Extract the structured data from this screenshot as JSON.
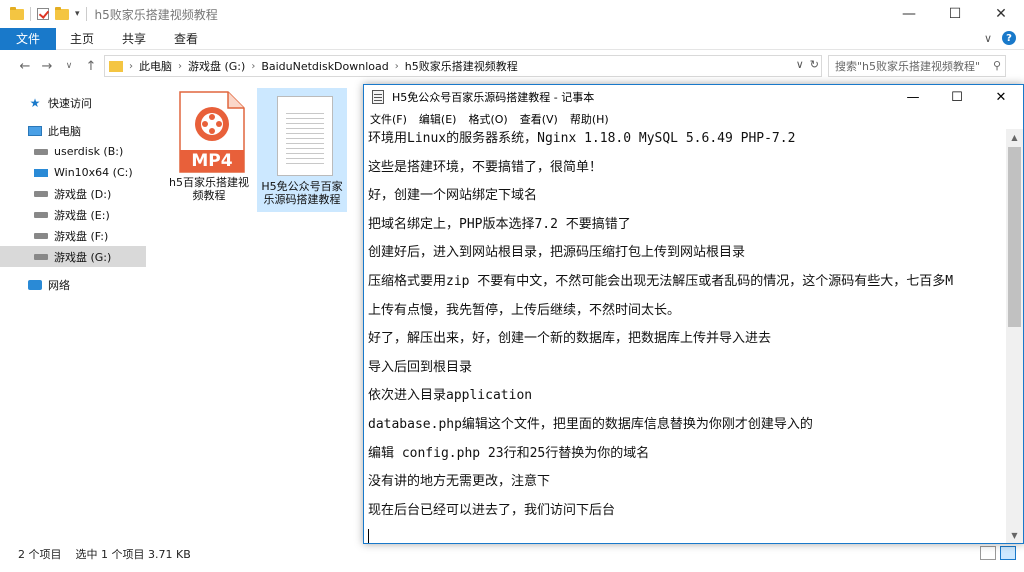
{
  "explorer": {
    "title": "h5败家乐搭建视频教程",
    "ribbon": {
      "file_tab": "文件",
      "tabs": [
        "主页",
        "共享",
        "查看"
      ]
    },
    "address": {
      "crumbs": [
        "此电脑",
        "游戏盘 (G:)",
        "BaiduNetdiskDownload",
        "h5败家乐搭建视频教程"
      ]
    },
    "search": {
      "placeholder": "搜索\"h5败家乐搭建视频教程\""
    },
    "sidebar": {
      "items": [
        {
          "label": "快速访问",
          "icon": "star-icon"
        },
        {
          "label": "此电脑",
          "icon": "computer-icon"
        },
        {
          "label": "userdisk (B:)",
          "icon": "drive-icon"
        },
        {
          "label": "Win10x64 (C:)",
          "icon": "windows-drive-icon"
        },
        {
          "label": "游戏盘 (D:)",
          "icon": "drive-icon"
        },
        {
          "label": "游戏盘 (E:)",
          "icon": "drive-icon"
        },
        {
          "label": "游戏盘 (F:)",
          "icon": "drive-icon"
        },
        {
          "label": "游戏盘 (G:)",
          "icon": "drive-icon"
        },
        {
          "label": "网络",
          "icon": "network-icon"
        }
      ]
    },
    "files": [
      {
        "name": "h5百家乐搭建视频教程",
        "type_label": "MP4"
      },
      {
        "name": "H5免公众号百家乐源码搭建教程",
        "type_label": ""
      }
    ],
    "status": {
      "count": "2 个项目",
      "selected": "选中 1 个项目  3.71 KB"
    },
    "accent_color": "#1979ca"
  },
  "notepad": {
    "title": "H5免公众号百家乐源码搭建教程 - 记事本",
    "menu": [
      "文件(F)",
      "编辑(E)",
      "格式(O)",
      "查看(V)",
      "帮助(H)"
    ],
    "lines": [
      "环境用Linux的服务器系统，Nginx 1.18.0 MySQL 5.6.49 PHP-7.2",
      "这些是搭建环境，不要搞错了，很简单！",
      "好，创建一个网站绑定下域名",
      "把域名绑定上，PHP版本选择7.2 不要搞错了",
      "创建好后，进入到网站根目录，把源码压缩打包上传到网站根目录",
      "压缩格式要用zip 不要有中文，不然可能会出现无法解压或者乱码的情况，这个源码有些大，七百多M",
      "上传有点慢，我先暂停，上传后继续，不然时间太长。",
      "好了，解压出来，好，创建一个新的数据库，把数据库上传并导入进去",
      "导入后回到根目录",
      "依次进入目录application",
      "database.php编辑这个文件，把里面的数据库信息替换为你刚才创建导入的",
      "编辑 config.php 23行和25行替换为你的域名",
      "没有讲的地方无需更改，注意下",
      "现在后台已经可以进去了，我们访问下后台"
    ]
  }
}
